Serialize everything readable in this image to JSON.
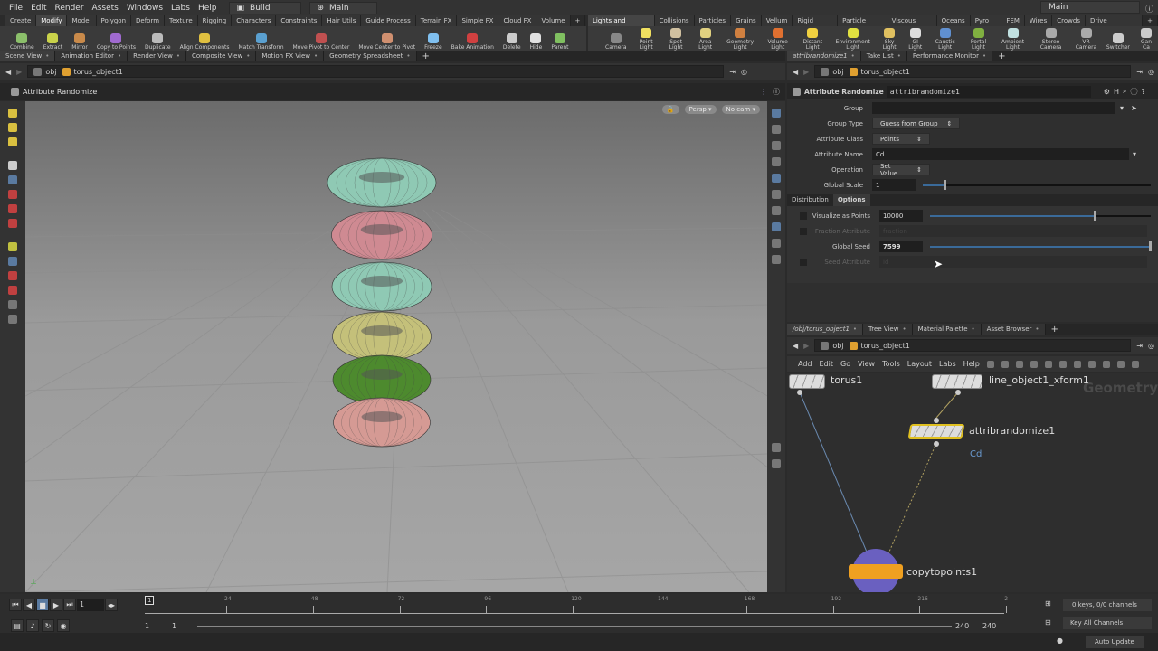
{
  "menubar": {
    "items": [
      "File",
      "Edit",
      "Render",
      "Assets",
      "Windows",
      "Labs",
      "Help"
    ],
    "desktop": "Build",
    "context": "Main",
    "right_context": "Main"
  },
  "shelf_left": {
    "tabs": [
      "Create",
      "Modify",
      "Model",
      "Polygon",
      "Deform",
      "Texture",
      "Rigging",
      "Characters",
      "Constraints",
      "Hair Utils",
      "Guide Process",
      "Terrain FX",
      "Simple FX",
      "Cloud FX",
      "Volume"
    ],
    "active_tab": "Modify",
    "tools": [
      {
        "label": "Combine",
        "color": "#8bbf6a"
      },
      {
        "label": "Extract",
        "color": "#c9d24a"
      },
      {
        "label": "Mirror",
        "color": "#c98a4a"
      },
      {
        "label": "Copy to Points",
        "color": "#a06ad0"
      },
      {
        "label": "Duplicate",
        "color": "#bbbbbb"
      },
      {
        "label": "Align Components",
        "color": "#e0c040"
      },
      {
        "label": "Match Transform",
        "color": "#5aa0d0"
      },
      {
        "label": "Move Pivot to Center",
        "color": "#c05050"
      },
      {
        "label": "Move Center to Pivot",
        "color": "#d09070"
      },
      {
        "label": "Freeze",
        "color": "#80c0f0"
      },
      {
        "label": "Bake Animation",
        "color": "#d04040"
      },
      {
        "label": "Delete",
        "color": "#cccccc"
      },
      {
        "label": "Hide",
        "color": "#e0e0e0"
      },
      {
        "label": "Parent",
        "color": "#80c060"
      }
    ]
  },
  "shelf_right": {
    "tabs": [
      "Lights and Cameras",
      "Collisions",
      "Particles",
      "Grains",
      "Vellum",
      "Rigid Bodies",
      "Particle Fluids",
      "Viscous Fluids",
      "Oceans",
      "Pyro FX",
      "FEM",
      "Wires",
      "Crowds",
      "Drive Simulation"
    ],
    "active_tab": "Lights and Cameras",
    "tools": [
      {
        "label": "Camera",
        "color": "#888888"
      },
      {
        "label": "Point Light",
        "color": "#f0e060"
      },
      {
        "label": "Spot Light",
        "color": "#d0c0a0"
      },
      {
        "label": "Area Light",
        "color": "#e0d080"
      },
      {
        "label": "Geometry Light",
        "color": "#d08040"
      },
      {
        "label": "Volume Light",
        "color": "#e07030"
      },
      {
        "label": "Distant Light",
        "color": "#f0d040"
      },
      {
        "label": "Environment Light",
        "color": "#e0e040"
      },
      {
        "label": "Sky Light",
        "color": "#e0c060"
      },
      {
        "label": "GI Light",
        "color": "#dddddd"
      },
      {
        "label": "Caustic Light",
        "color": "#6090d0"
      },
      {
        "label": "Portal Light",
        "color": "#80b040"
      },
      {
        "label": "Ambient Light",
        "color": "#c0e0e0"
      },
      {
        "label": "Stereo Camera",
        "color": "#aaaaaa"
      },
      {
        "label": "VR Camera",
        "color": "#aaaaaa"
      },
      {
        "label": "Switcher",
        "color": "#cccccc"
      },
      {
        "label": "Gan Ca",
        "color": "#cccccc"
      }
    ]
  },
  "left_pane": {
    "tabs": [
      "Scene View",
      "Animation Editor",
      "Render View",
      "Composite View",
      "Motion FX View",
      "Geometry Spreadsheet"
    ],
    "path": [
      "obj",
      "torus_object1"
    ],
    "tool_title": "Attribute Randomize",
    "viewport": {
      "camera_mode": "Persp",
      "camera": "No cam"
    }
  },
  "params_pane": {
    "tabs": [
      "attribrandomize1",
      "Take List",
      "Performance Monitor"
    ],
    "path": [
      "obj",
      "torus_object1"
    ],
    "node_type": "Attribute Randomize",
    "node_name": "attribrandomize1",
    "parms": {
      "group": {
        "label": "Group",
        "value": ""
      },
      "group_type": {
        "label": "Group Type",
        "value": "Guess from Group"
      },
      "attribute_class": {
        "label": "Attribute Class",
        "value": "Points"
      },
      "attribute_name": {
        "label": "Attribute Name",
        "value": "Cd"
      },
      "operation": {
        "label": "Operation",
        "value": "Set Value"
      },
      "global_scale": {
        "label": "Global Scale",
        "value": "1",
        "slider": 0.1
      }
    },
    "sub_tabs": [
      "Distribution",
      "Options"
    ],
    "active_sub_tab": "Options",
    "options": {
      "visualize_points": {
        "label": "Visualize as Points",
        "value": "10000",
        "slider": 0.75
      },
      "fraction_attribute": {
        "label": "Fraction Attribute",
        "value": "fraction"
      },
      "global_seed": {
        "label": "Global Seed",
        "value": "7599",
        "slider": 1.0
      },
      "seed_attribute": {
        "label": "Seed Attribute",
        "value": "id"
      }
    }
  },
  "network_pane": {
    "tabs": [
      "/obj/torus_object1",
      "Tree View",
      "Material Palette",
      "Asset Browser"
    ],
    "path": [
      "obj",
      "torus_object1"
    ],
    "menu": [
      "Add",
      "Edit",
      "Go",
      "View",
      "Tools",
      "Layout",
      "Labs",
      "Help"
    ],
    "context_label": "Geometry",
    "nodes": [
      {
        "name": "torus1"
      },
      {
        "name": "line_object1_xform1"
      },
      {
        "name": "attribrandomize1",
        "flag": "Cd"
      },
      {
        "name": "copytopoints1"
      }
    ]
  },
  "timeline": {
    "current_frame": "1",
    "ticks": [
      "24",
      "48",
      "72",
      "96",
      "120",
      "144",
      "168",
      "192",
      "216",
      "2"
    ],
    "marker": "1",
    "range_start": "1",
    "range_start2": "1",
    "range_end": "240",
    "range_end2": "240",
    "keys_info": "0 keys, 0/0 channels",
    "key_mode": "Key All Channels"
  },
  "status": {
    "update_mode": "Auto Update"
  },
  "toruses": [
    "#8fc9b4",
    "#cf8a92",
    "#8fc9b4",
    "#c4c07a",
    "#4d8a2e",
    "#d59a94"
  ]
}
